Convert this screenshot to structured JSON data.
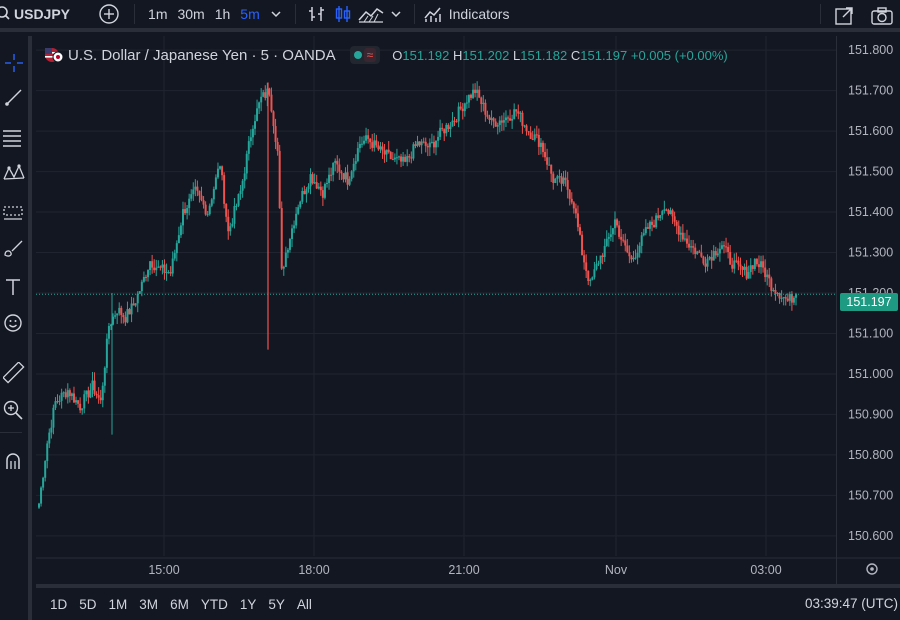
{
  "toolbar": {
    "symbol": "USDJPY",
    "intervals": [
      "1m",
      "30m",
      "1h",
      "5m"
    ],
    "active_interval": "5m",
    "indicators_label": "Indicators"
  },
  "legend": {
    "title": "U.S. Dollar / Japanese Yen · 5 · OANDA",
    "o_key": "O",
    "o_val": "151.192",
    "h_key": "H",
    "h_val": "151.202",
    "l_key": "L",
    "l_val": "151.182",
    "c_key": "C",
    "c_val": "151.197",
    "change": "+0.005 (+0.00%)"
  },
  "last_price": "151.197",
  "bottom": {
    "ranges": [
      "1D",
      "5D",
      "1M",
      "3M",
      "6M",
      "YTD",
      "1Y",
      "5Y",
      "All"
    ],
    "clock": "03:39:47 (UTC)"
  },
  "colors": {
    "up": "#26a69a",
    "down": "#ef5350",
    "background": "#131722",
    "accent": "#2962ff"
  },
  "chart_data": {
    "type": "candlestick",
    "y_ticks": [
      "151.800",
      "151.700",
      "151.600",
      "151.500",
      "151.400",
      "151.300",
      "151.200",
      "151.100",
      "151.000",
      "150.900",
      "150.800",
      "150.700",
      "150.600"
    ],
    "ylim": [
      150.57,
      151.83
    ],
    "x_labels": [
      "15:00",
      "18:00",
      "21:00",
      "Nov",
      "03:00"
    ],
    "grid": true,
    "last": 151.197,
    "segments": [
      [
        0,
        150.68
      ],
      [
        4,
        150.83
      ],
      [
        8,
        150.93
      ],
      [
        14,
        150.96
      ],
      [
        20,
        150.92
      ],
      [
        26,
        150.97
      ],
      [
        30,
        150.93
      ],
      [
        34,
        151.12
      ],
      [
        38,
        151.16
      ],
      [
        42,
        151.14
      ],
      [
        46,
        151.17
      ],
      [
        50,
        151.22
      ],
      [
        54,
        151.28
      ],
      [
        58,
        151.26
      ],
      [
        64,
        151.25
      ],
      [
        70,
        151.4
      ],
      [
        76,
        151.45
      ],
      [
        82,
        151.4
      ],
      [
        88,
        151.52
      ],
      [
        92,
        151.35
      ],
      [
        98,
        151.45
      ],
      [
        104,
        151.62
      ],
      [
        108,
        151.68
      ],
      [
        112,
        151.7
      ],
      [
        116,
        151.55
      ],
      [
        118,
        151.25
      ],
      [
        120,
        151.3
      ],
      [
        126,
        151.42
      ],
      [
        132,
        151.49
      ],
      [
        138,
        151.45
      ],
      [
        144,
        151.52
      ],
      [
        150,
        151.48
      ],
      [
        156,
        151.57
      ],
      [
        160,
        151.58
      ],
      [
        166,
        151.55
      ],
      [
        172,
        151.53
      ],
      [
        178,
        151.52
      ],
      [
        184,
        151.57
      ],
      [
        190,
        151.56
      ],
      [
        196,
        151.6
      ],
      [
        202,
        151.63
      ],
      [
        208,
        151.68
      ],
      [
        212,
        151.7
      ],
      [
        216,
        151.66
      ],
      [
        220,
        151.62
      ],
      [
        226,
        151.63
      ],
      [
        232,
        151.65
      ],
      [
        238,
        151.6
      ],
      [
        244,
        151.57
      ],
      [
        250,
        151.48
      ],
      [
        256,
        151.47
      ],
      [
        260,
        151.42
      ],
      [
        264,
        151.3
      ],
      [
        268,
        151.22
      ],
      [
        272,
        151.28
      ],
      [
        276,
        151.32
      ],
      [
        280,
        151.38
      ],
      [
        284,
        151.32
      ],
      [
        288,
        151.28
      ],
      [
        292,
        151.32
      ],
      [
        296,
        151.36
      ],
      [
        300,
        151.38
      ],
      [
        304,
        151.42
      ],
      [
        308,
        151.38
      ],
      [
        312,
        151.35
      ],
      [
        316,
        151.32
      ],
      [
        320,
        151.3
      ],
      [
        324,
        151.28
      ],
      [
        328,
        151.3
      ],
      [
        332,
        151.32
      ],
      [
        336,
        151.28
      ],
      [
        340,
        151.26
      ],
      [
        344,
        151.25
      ],
      [
        348,
        151.28
      ],
      [
        352,
        151.26
      ],
      [
        356,
        151.22
      ],
      [
        360,
        151.2
      ],
      [
        364,
        151.18
      ],
      [
        368,
        151.197
      ]
    ]
  }
}
